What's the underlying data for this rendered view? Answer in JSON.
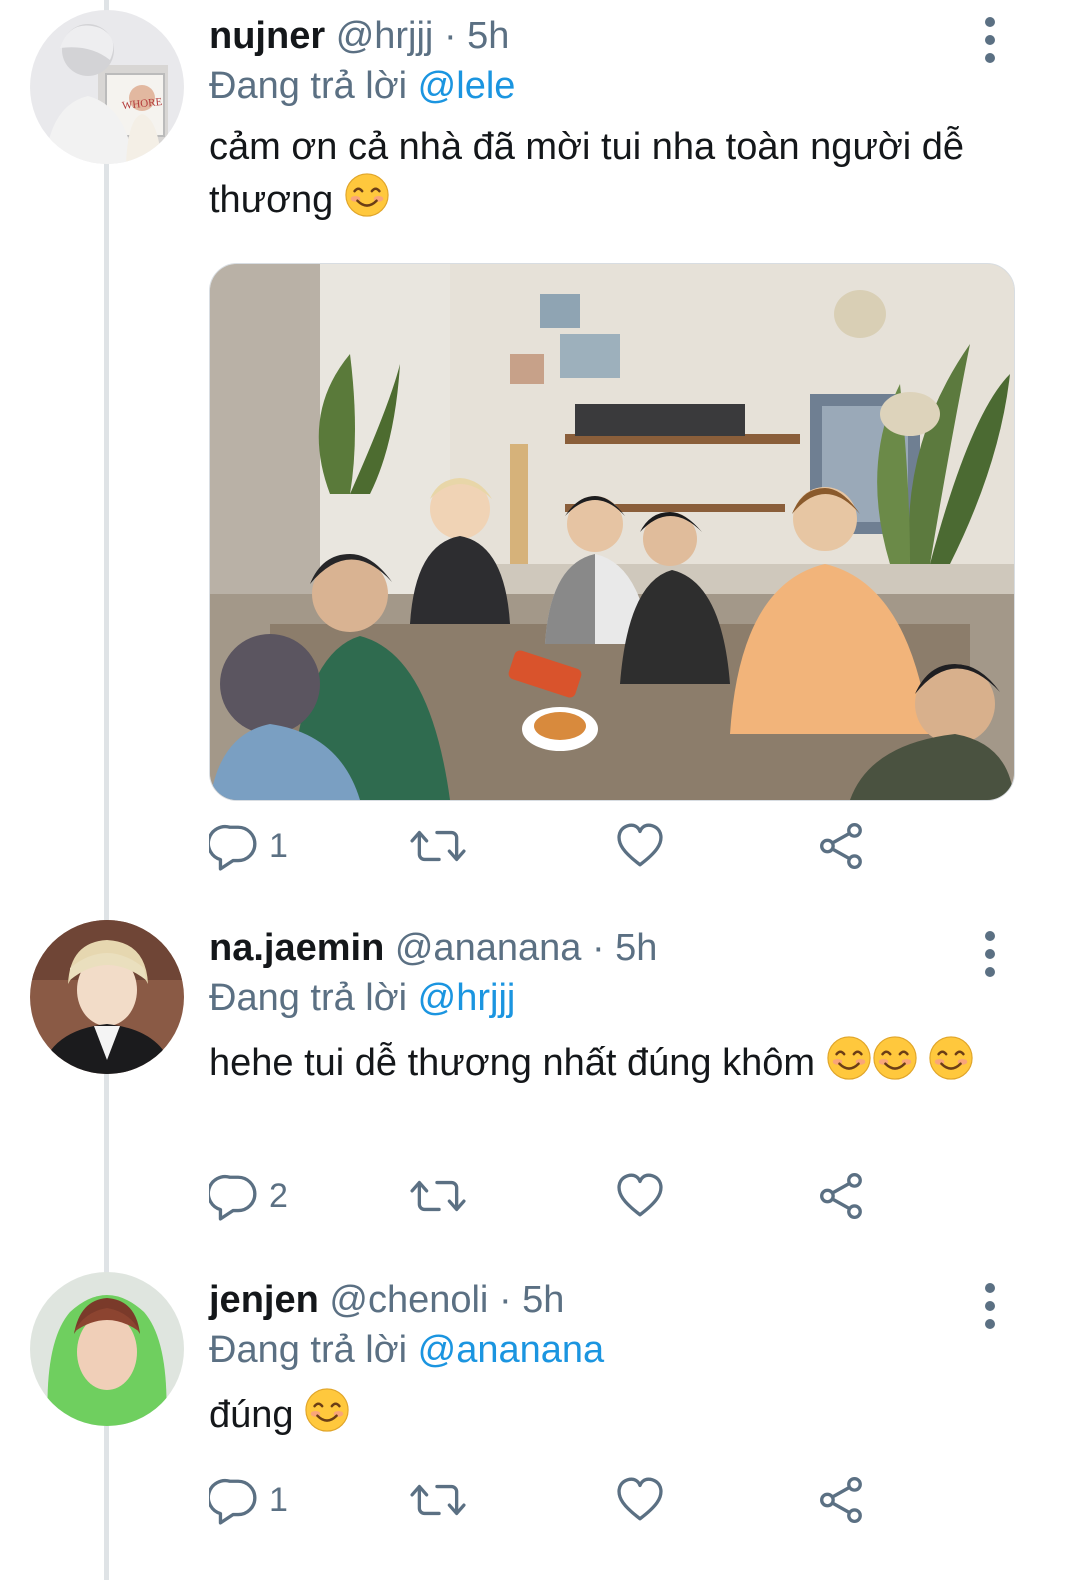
{
  "tweets": [
    {
      "name": "nujner",
      "handle": "@hrjjj",
      "time": "5h",
      "reply_prefix": "Đang trả lời",
      "reply_to": "@lele",
      "text": "cảm ơn cả nhà đã mời tui nha toàn người dễ thương",
      "emoji_count": 1,
      "avatar_text": "WHORE",
      "media": "photo",
      "stats": {
        "replies": "1",
        "retweets": "",
        "likes": ""
      }
    },
    {
      "name": "na.jaemin",
      "handle": "@ananana",
      "time": "5h",
      "reply_prefix": "Đang trả lời",
      "reply_to": "@hrjjj",
      "text": "hehe tui dễ thương nhất đúng khôm",
      "emoji_count": 3,
      "stats": {
        "replies": "2",
        "retweets": "",
        "likes": ""
      }
    },
    {
      "name": "jenjen",
      "handle": "@chenoli",
      "time": "5h",
      "reply_prefix": "Đang trả lời",
      "reply_to": "@ananana",
      "text": "đúng",
      "emoji_count": 1,
      "stats": {
        "replies": "1",
        "retweets": "",
        "likes": ""
      }
    }
  ],
  "separator": "·",
  "colors": {
    "link": "#1b95e0",
    "secondary": "#5b7083",
    "thread_line": "#dfe3e6"
  },
  "icons": [
    "reply-icon",
    "retweet-icon",
    "like-icon",
    "share-icon",
    "more-icon",
    "smiling-emoji"
  ]
}
